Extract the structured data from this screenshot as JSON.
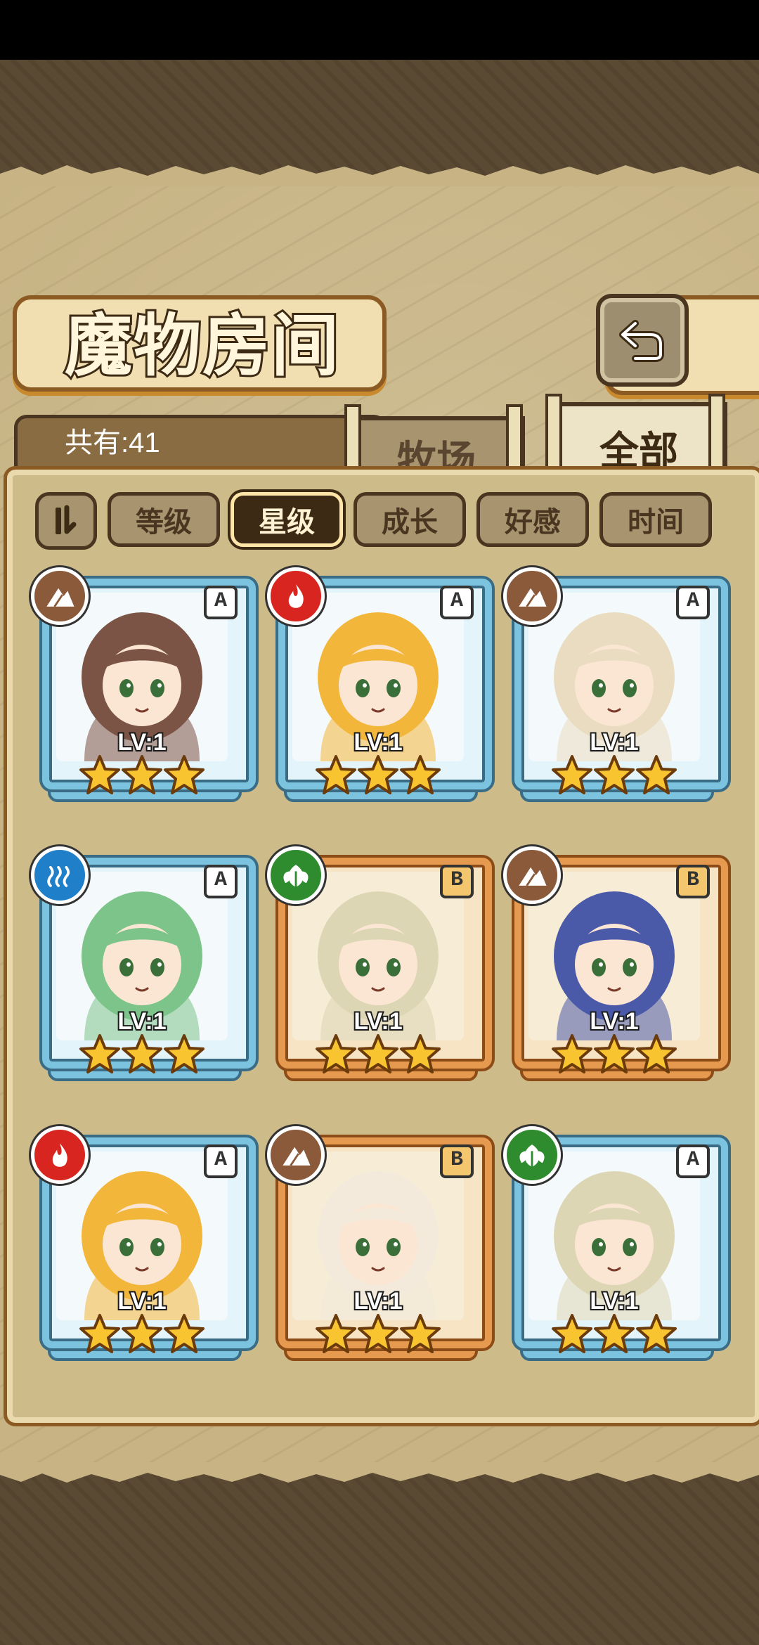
{
  "header": {
    "title": "魔物房间",
    "back_icon": "return-arrow-icon"
  },
  "summary": {
    "count_label": "共有:41"
  },
  "tabs": [
    {
      "label": "牧场",
      "active": false
    },
    {
      "label": "全部",
      "active": true
    }
  ],
  "sort": {
    "toggle_icon": "sort-order-icon",
    "options": [
      {
        "label": "等级",
        "selected": false
      },
      {
        "label": "星级",
        "selected": true
      },
      {
        "label": "成长",
        "selected": false
      },
      {
        "label": "好感",
        "selected": false
      },
      {
        "label": "时间",
        "selected": false
      }
    ]
  },
  "monsters": [
    {
      "rarity": "A",
      "element": "earth",
      "level": "LV:1",
      "stars": 3,
      "hair": "#7b5445"
    },
    {
      "rarity": "A",
      "element": "fire",
      "level": "LV:1",
      "stars": 3,
      "hair": "#f2b63a"
    },
    {
      "rarity": "A",
      "element": "earth",
      "level": "LV:1",
      "stars": 3,
      "hair": "#e9dcc1"
    },
    {
      "rarity": "A",
      "element": "water",
      "level": "LV:1",
      "stars": 3,
      "hair": "#7cc48a"
    },
    {
      "rarity": "B",
      "element": "wind",
      "level": "LV:1",
      "stars": 3,
      "hair": "#ddd6b4"
    },
    {
      "rarity": "B",
      "element": "earth",
      "level": "LV:1",
      "stars": 3,
      "hair": "#4a5aa8"
    },
    {
      "rarity": "A",
      "element": "fire",
      "level": "LV:1",
      "stars": 3,
      "hair": "#f2b63a"
    },
    {
      "rarity": "B",
      "element": "earth",
      "level": "LV:1",
      "stars": 3,
      "hair": "#f3eadb"
    },
    {
      "rarity": "A",
      "element": "wind",
      "level": "LV:1",
      "stars": 3,
      "hair": "#ddd6b4"
    }
  ],
  "colors": {
    "element_fire": "#d8251f",
    "element_earth": "#8a5a3a",
    "element_water": "#1f7fc8",
    "element_wind": "#2e8c2e",
    "star": "#f8c531"
  }
}
